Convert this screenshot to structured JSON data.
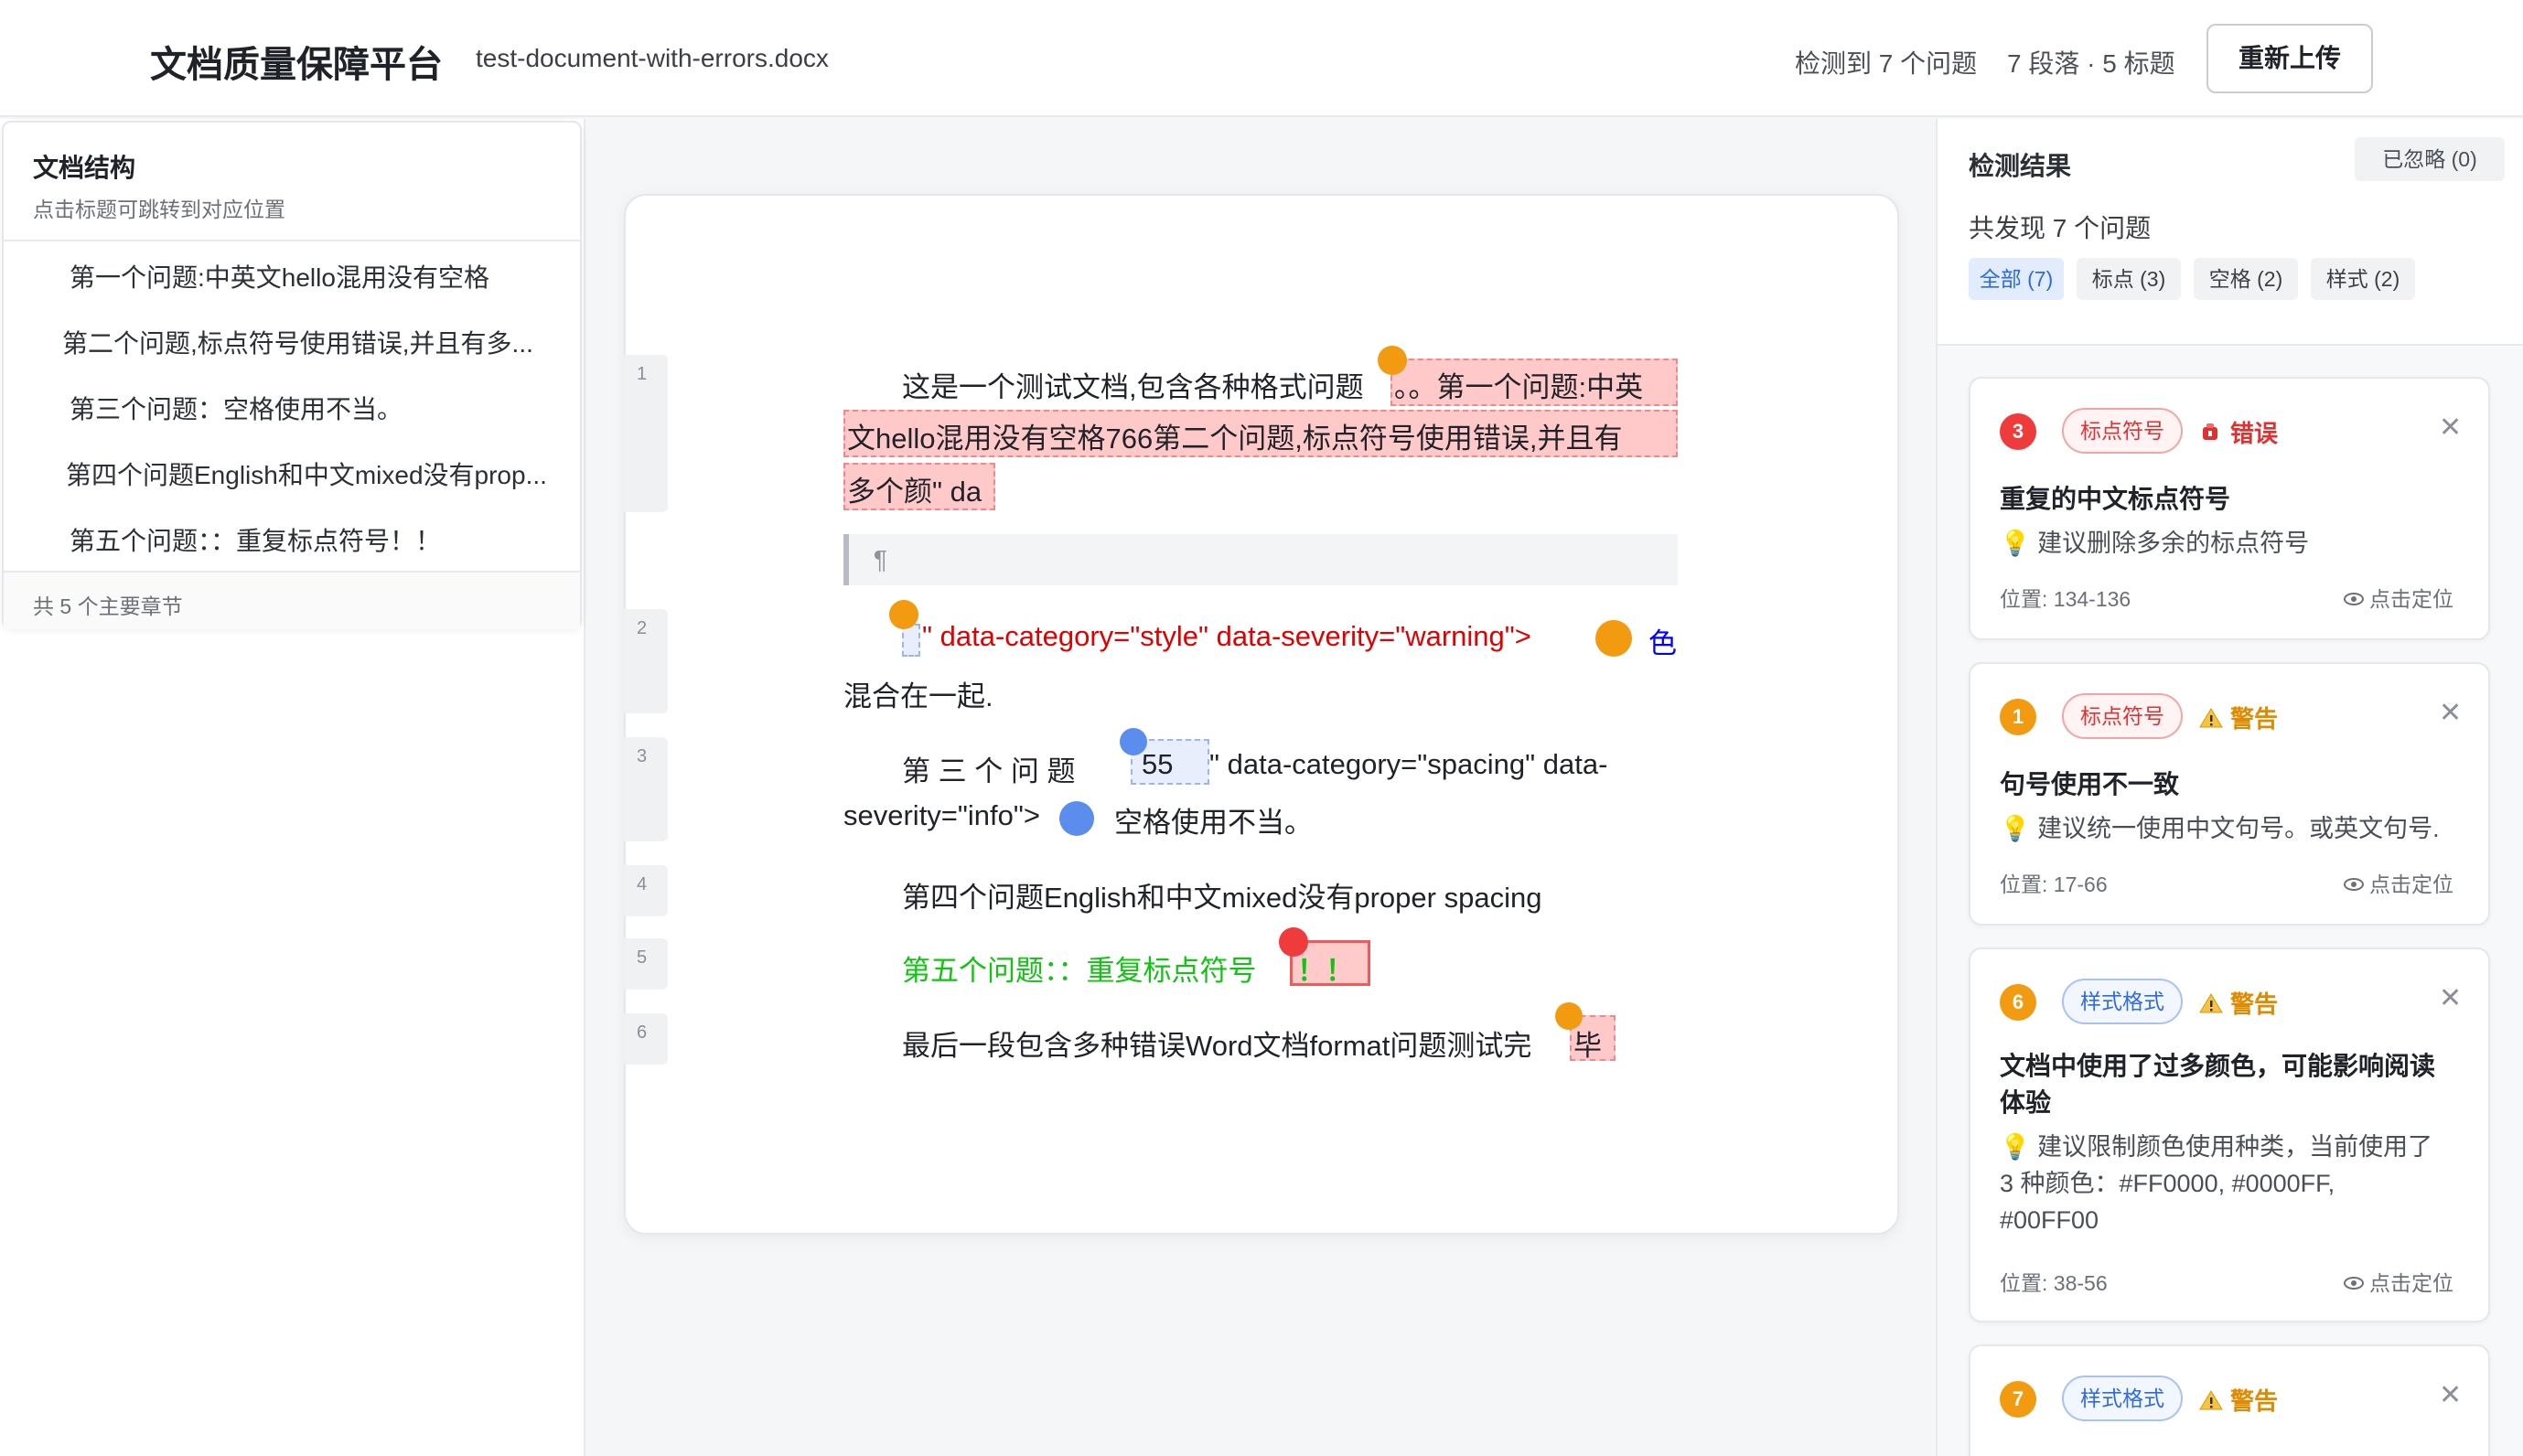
{
  "header": {
    "title": "文档质量保障平台",
    "file_name": "test-document-with-errors.docx",
    "issues_detected": "检测到 7 个问题",
    "structure_summary": "7 段落 · 5 标题",
    "reupload_label": "重新上传"
  },
  "toc": {
    "title": "文档结构",
    "subtitle": "点击标题可跳转到对应位置",
    "items": [
      "第一个问题:中英文hello混用没有空格",
      "第二个问题,标点符号使用错误,并且有多...",
      "第三个问题：空格使用不当。",
      "第四个问题English和中文mixed没有prop...",
      "第五个问题：：重复标点符号！！"
    ],
    "footer": "共 5 个主要章节"
  },
  "document": {
    "line_numbers": [
      "1",
      "2",
      "3",
      "4",
      "5",
      "6"
    ],
    "p1_a": "这是一个测试文档,包含各种格式问题",
    "p1_err1": "。。第一个问题:中英",
    "p1_err2": "文hello混用没有空格766第二个问题,标点符号使用错误,并且有",
    "p1_err3": "多个颜\" da",
    "pilcrow": "¶",
    "p2_red": "\" data-category=\"style\" data-severity=\"warning\">",
    "p2_blue": "色",
    "p2_line2": "混合在一起.",
    "p3_a": "第 三 个 问 题",
    "p3_box": "55",
    "p3_b": "\"  data-category=\"spacing\"  data-",
    "p3_c": "severity=\"info\">",
    "p3_d": "空格使用不当。",
    "p4": "第四个问题English和中文mixed没有proper spacing",
    "p5": "第五个问题：：重复标点符号",
    "p5_box": "！！",
    "p6": "最后一段包含多种错误Word文档format问题测试完",
    "p6_box": "毕"
  },
  "results": {
    "title": "检测结果",
    "ignored": "已忽略 (0)",
    "found": "共发现 7 个问题",
    "filters": [
      "全部 (7)",
      "标点 (3)",
      "空格 (2)",
      "样式 (2)"
    ],
    "issues": [
      {
        "number": "3",
        "category": "标点符号",
        "severity": "错误",
        "title": "重复的中文标点符号",
        "suggestion": "💡 建议删除多余的标点符号",
        "position": "位置: 134-136",
        "locate": "点击定位"
      },
      {
        "number": "1",
        "category": "标点符号",
        "severity": "警告",
        "title": "句号使用不一致",
        "suggestion": "💡 建议统一使用中文句号。或英文句号.",
        "position": "位置: 17-66",
        "locate": "点击定位"
      },
      {
        "number": "6",
        "category": "样式格式",
        "severity": "警告",
        "title_line1": "文档中使用了过多颜色，可能影响阅读",
        "title_line2": "体验",
        "suggestion_line1": "💡 建议限制颜色使用种类，当前使用了",
        "suggestion_line2": "3 种颜色：#FF0000, #0000FF,",
        "suggestion_line3": "#00FF00",
        "position": "位置: 38-56",
        "locate": "点击定位"
      },
      {
        "number": "7",
        "category": "样式格式",
        "severity": "警告"
      }
    ]
  },
  "colors": {
    "error": "#ef3b3b",
    "warning": "#f29a10",
    "info": "#5b8def",
    "accent": "#2f6ae0",
    "doc_red": "#FF0000",
    "doc_blue": "#0000FF",
    "doc_green": "#00FF00"
  }
}
